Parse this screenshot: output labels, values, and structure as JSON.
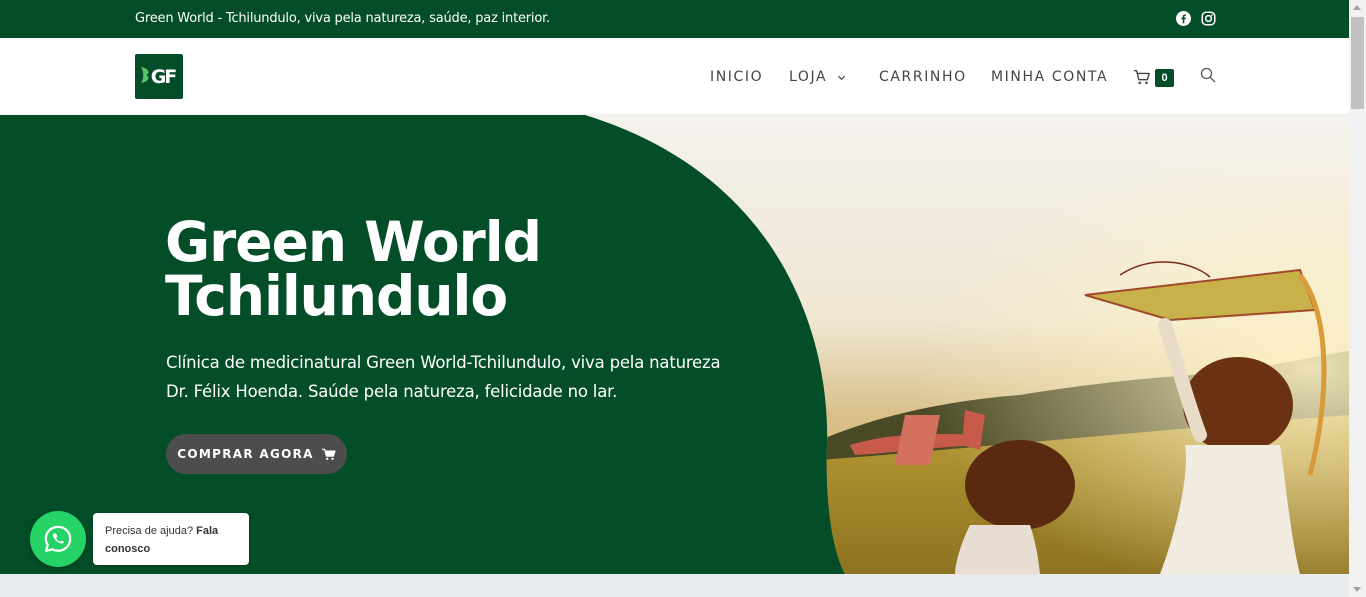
{
  "topbar": {
    "tagline": "Green World - Tchilundulo, viva pela natureza, saúde, paz interior.",
    "social_icons": [
      "facebook-icon",
      "instagram-icon"
    ]
  },
  "header": {
    "logo_text": "GF",
    "nav": {
      "inicio": "INICIO",
      "loja": "LOJA",
      "carrinho": "CARRINHO",
      "minha_conta": "MINHA CONTA"
    },
    "cart_count": "0"
  },
  "hero": {
    "title_line1": "Green World",
    "title_line2": "Tchilundulo",
    "subtitle_line1": "Clínica de medicinatural Green World-Tchilundulo, viva pela natureza",
    "subtitle_line2": "Dr. Félix Hoenda. Saúde pela natureza, felicidade no lar.",
    "cta_label": "COMPRAR AGORA"
  },
  "whatsapp": {
    "prompt": "Precisa de ajuda?",
    "prompt_bold": "Fala conosco"
  },
  "colors": {
    "brand_green": "#034d28",
    "button_gray": "#4e4d4d",
    "whatsapp_green": "#25d366"
  }
}
